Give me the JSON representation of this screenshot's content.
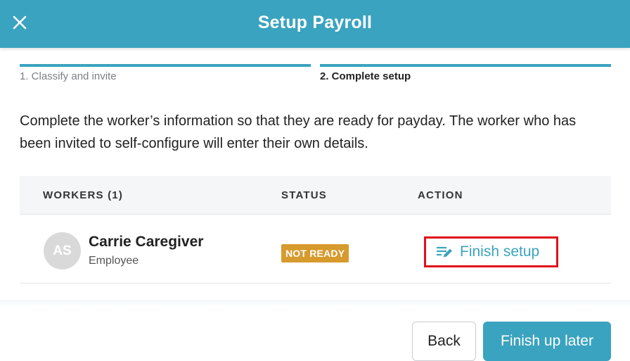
{
  "header": {
    "title": "Setup Payroll",
    "close_icon": "close-icon",
    "color": "#3aa3bf"
  },
  "steps": [
    {
      "label": "1. Classify and invite",
      "active": false
    },
    {
      "label": "2. Complete setup",
      "active": true
    }
  ],
  "intro_text": "Complete the worker’s information so that they are ready for payday. The worker who has been invited to self-configure will enter their own details.",
  "table": {
    "columns": [
      "WORKERS (1)",
      "STATUS",
      "ACTION"
    ],
    "rows": [
      {
        "initials": "AS",
        "name": "Carrie Caregiver",
        "role": "Employee",
        "status": "NOT READY",
        "status_color": "#d69a2d",
        "action_label": "Finish setup",
        "action_icon": "edit-list-icon"
      }
    ]
  },
  "footer": {
    "back_label": "Back",
    "later_label": "Finish up later"
  },
  "colors": {
    "accent": "#3aa3bf",
    "highlight": "#e0101a"
  }
}
